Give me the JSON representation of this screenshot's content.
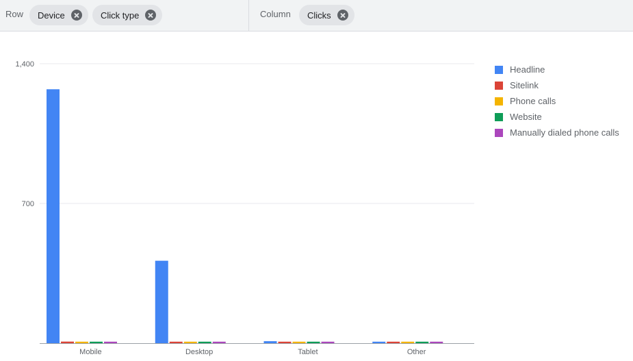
{
  "toolbar": {
    "row_label": "Row",
    "row_chips": [
      {
        "label": "Device"
      },
      {
        "label": "Click type"
      }
    ],
    "column_label": "Column",
    "column_chips": [
      {
        "label": "Clicks"
      }
    ]
  },
  "chart_data": {
    "type": "bar",
    "categories": [
      "Mobile",
      "Desktop",
      "Tablet",
      "Other"
    ],
    "series": [
      {
        "name": "Headline",
        "color": "#4285f4",
        "values": [
          1272,
          413,
          10,
          1
        ]
      },
      {
        "name": "Sitelink",
        "color": "#db4437",
        "values": [
          8,
          7,
          1,
          0
        ]
      },
      {
        "name": "Phone calls",
        "color": "#f4b400",
        "values": [
          2,
          0,
          0,
          0
        ]
      },
      {
        "name": "Website",
        "color": "#0f9d58",
        "values": [
          2,
          1,
          1,
          1
        ]
      },
      {
        "name": "Manually dialed phone calls",
        "color": "#ab47bc",
        "values": [
          1,
          1,
          1,
          0
        ]
      }
    ],
    "yticks": [
      "1,400",
      "700"
    ],
    "ylim": [
      0,
      1400
    ],
    "grid": true,
    "legend_position": "right"
  }
}
